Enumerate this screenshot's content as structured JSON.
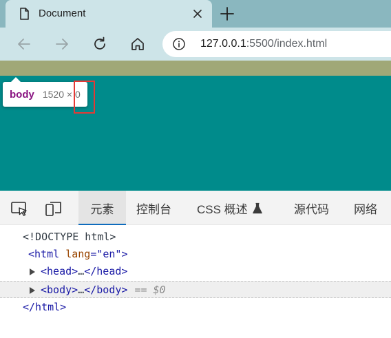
{
  "tab": {
    "title": "Document",
    "icon": "document-icon"
  },
  "toolbar": {
    "back_icon": "back-arrow-icon",
    "forward_icon": "forward-arrow-icon",
    "reload_icon": "reload-icon",
    "home_icon": "home-icon",
    "url_host": "127.0.0.1",
    "url_rest": ":5500/index.html"
  },
  "inspect_tooltip": {
    "tag": "body",
    "size": "1520 × 0"
  },
  "devtools": {
    "tabs": [
      {
        "label": "元素",
        "active": true
      },
      {
        "label": "控制台"
      },
      {
        "label": "CSS 概述"
      },
      {
        "label": "源代码"
      },
      {
        "label": "网络"
      }
    ],
    "dom": {
      "doctype": "<!DOCTYPE html>",
      "html_open_tag": "<html",
      "html_attr_name": "lang",
      "html_attr_eq": "=",
      "html_attr_value": "\"en\"",
      "html_open_close": ">",
      "head_open": "<head>",
      "head_ellipsis": "…",
      "head_close": "</head>",
      "body_open": "<body>",
      "body_ellipsis": "…",
      "body_close": "</body>",
      "selected_marker": "== $0",
      "html_close": "</html>"
    }
  },
  "colors": {
    "page_background": "#008b8b",
    "body_overlay": "#a0a877",
    "tag_color": "#881280",
    "highlight": "#e53935",
    "active_tab_underline": "#0f6cbd"
  }
}
